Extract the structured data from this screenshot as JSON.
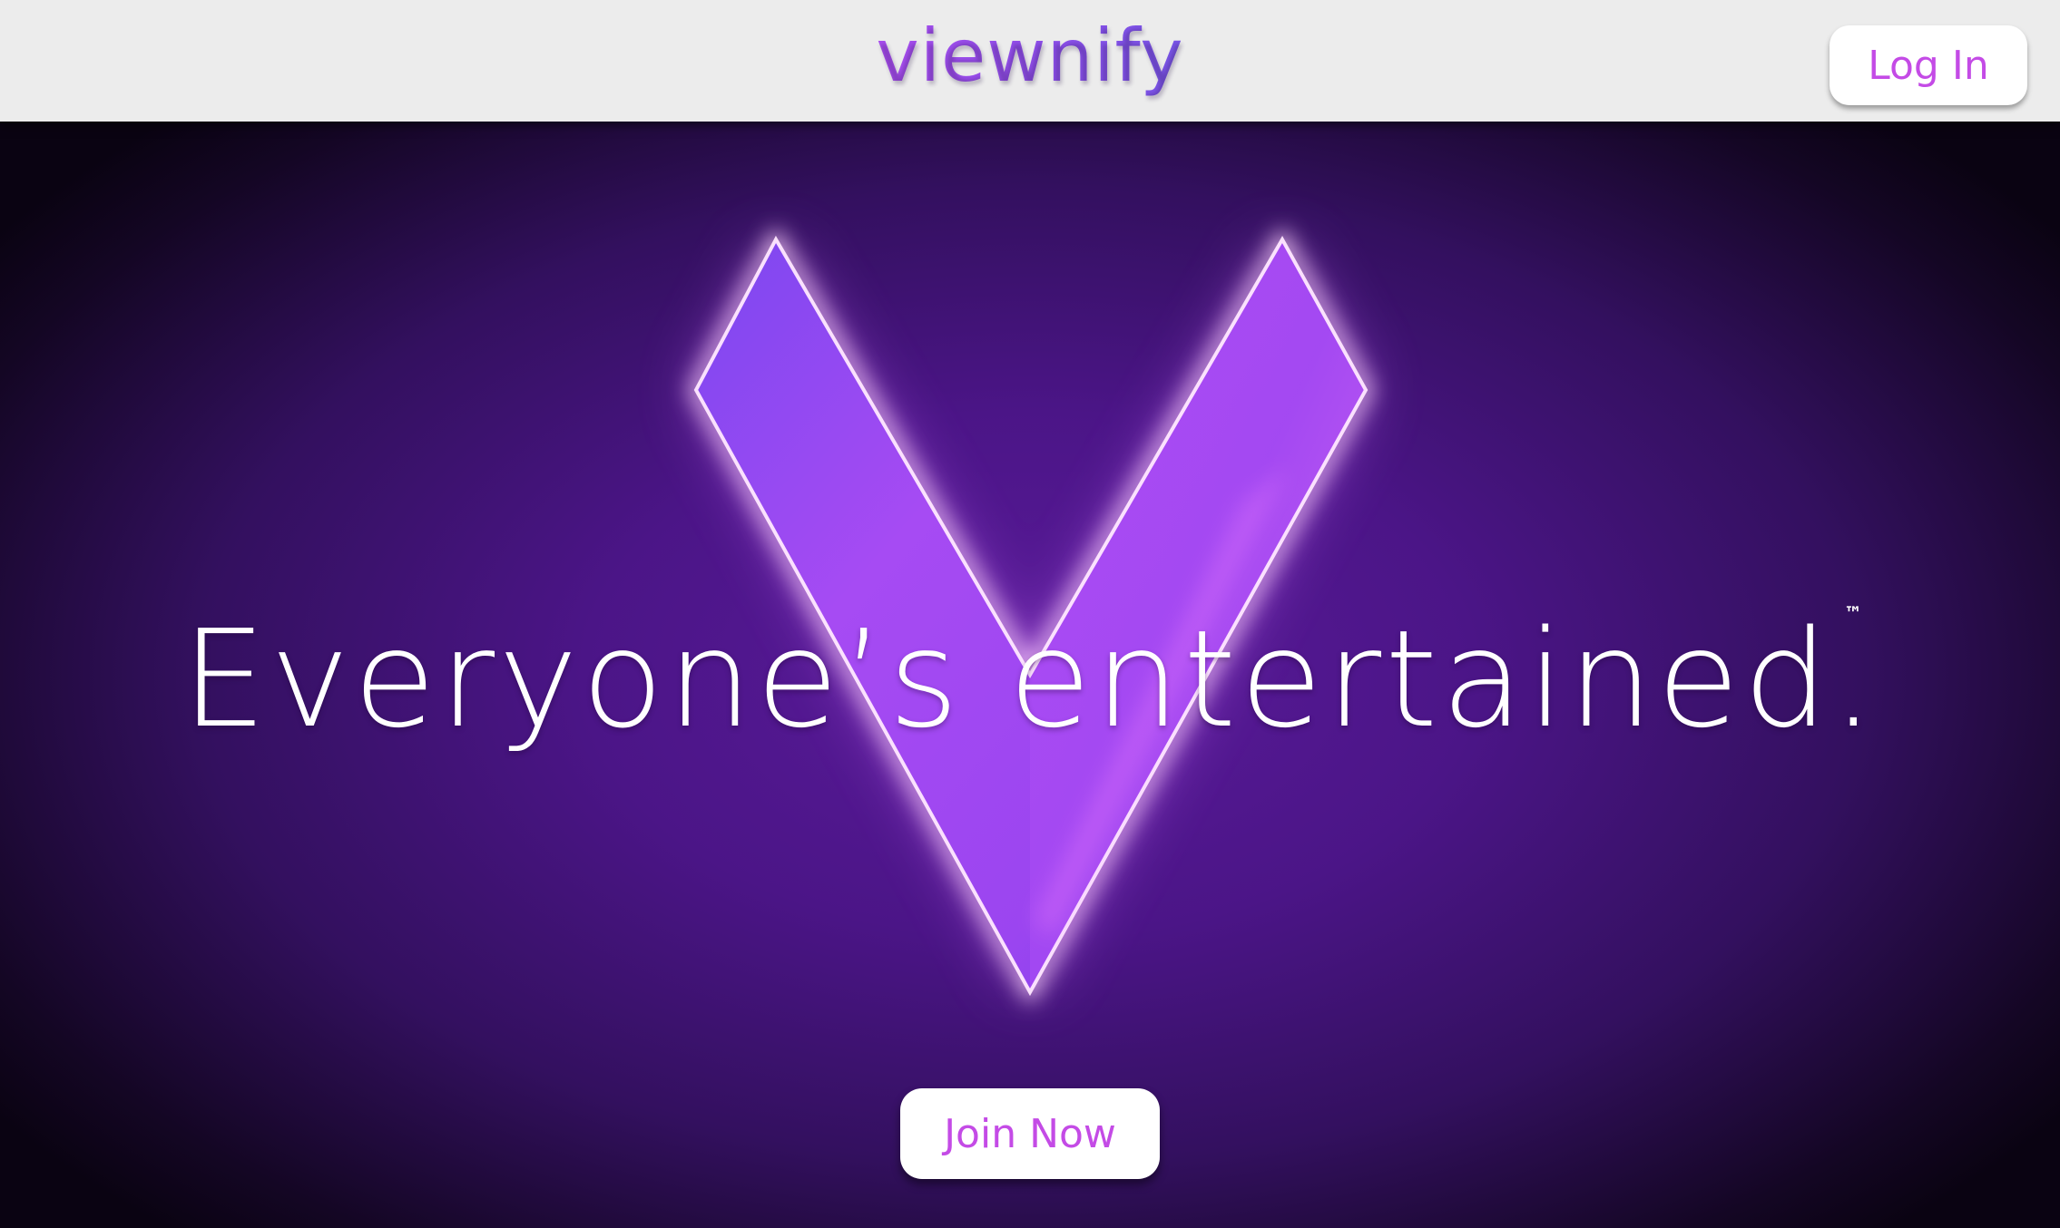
{
  "header": {
    "brand": "viewnify",
    "login_label": "Log In"
  },
  "hero": {
    "headline": "Everyone’s entertained.",
    "trademark": "™",
    "join_label": "Join Now",
    "logo_name": "v-logo"
  },
  "colors": {
    "accent": "#c44be6",
    "brand_gradient_start": "#b64cf0",
    "brand_gradient_end": "#6d59e6",
    "background_center": "#5a1b9a",
    "background_edge": "#0a0312",
    "header_bg": "#ececec"
  }
}
